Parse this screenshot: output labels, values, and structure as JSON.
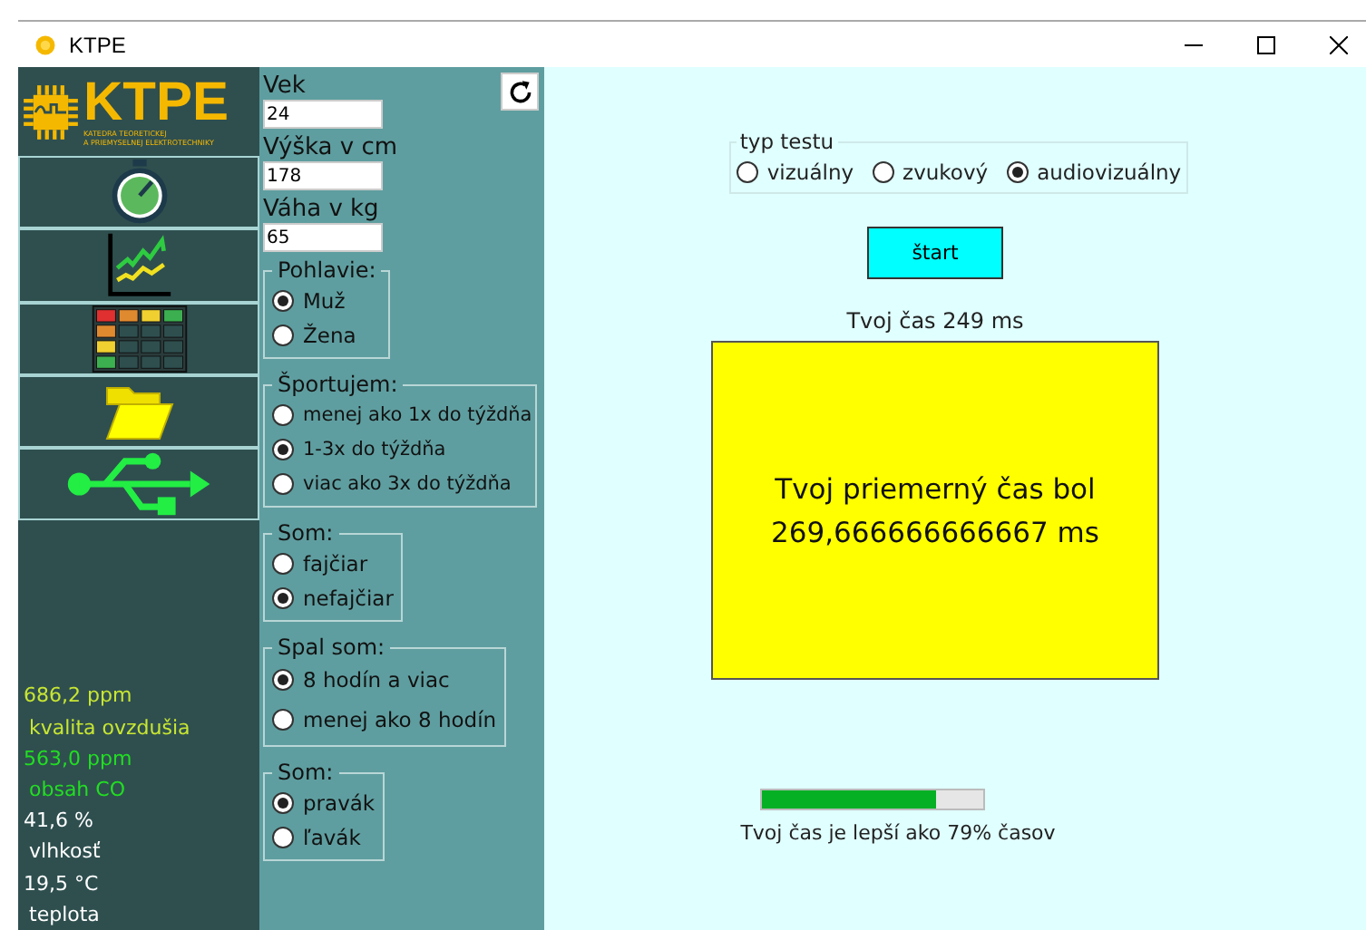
{
  "window": {
    "title": "KTPE"
  },
  "sidebar": {
    "logo": {
      "name": "KTPE",
      "subtitle_1": "KATEDRA TEORETICKEJ",
      "subtitle_2": "A PRIEMYSELNEJ ELEKTROTECHNIKY"
    },
    "nav": [
      {
        "kind": "stopwatch"
      },
      {
        "kind": "chart"
      },
      {
        "kind": "table"
      },
      {
        "kind": "folder"
      },
      {
        "kind": "usb"
      }
    ],
    "sensors": [
      {
        "value": "686,2 ppm",
        "label": "kvalita ovzdušia",
        "color": "#c8e632"
      },
      {
        "value": "563,0 ppm",
        "label": "obsah CO",
        "color": "#22dd22"
      },
      {
        "value": "41,6 %",
        "label": "vlhkosť",
        "color": "#ffffff"
      },
      {
        "value": "19,5 °C",
        "label": "teplota",
        "color": "#ffffff"
      }
    ]
  },
  "form": {
    "fields": [
      {
        "label": "Vek",
        "value": "24"
      },
      {
        "label": "Výška v cm",
        "value": "178"
      },
      {
        "label": "Váha v kg",
        "value": "65"
      }
    ],
    "groups": [
      {
        "title": "Pohlavie:",
        "options": [
          {
            "label": "Muž",
            "selected": true
          },
          {
            "label": "Žena",
            "selected": false
          }
        ]
      },
      {
        "title": "Športujem:",
        "options": [
          {
            "label": "menej ako 1x do týždňa",
            "selected": false
          },
          {
            "label": "1-3x do týždňa",
            "selected": true
          },
          {
            "label": "viac ako 3x do týždňa",
            "selected": false
          }
        ]
      },
      {
        "title": "Som:",
        "options": [
          {
            "label": "fajčiar",
            "selected": false
          },
          {
            "label": "nefajčiar",
            "selected": true
          }
        ]
      },
      {
        "title": "Spal som:",
        "options": [
          {
            "label": "8 hodín a viac",
            "selected": true
          },
          {
            "label": "menej ako 8 hodín",
            "selected": false
          }
        ]
      },
      {
        "title": "Som:",
        "options": [
          {
            "label": "pravák",
            "selected": true
          },
          {
            "label": "ľavák",
            "selected": false
          }
        ]
      }
    ]
  },
  "test": {
    "type_group": {
      "title": "typ testu",
      "options": [
        {
          "label": "vizuálny",
          "selected": false
        },
        {
          "label": "zvukový",
          "selected": false
        },
        {
          "label": "audiovizuálny",
          "selected": true
        }
      ]
    },
    "start_button": "štart",
    "last_time": "Tvoj čas 249 ms",
    "average_line_1": "Tvoj priemerný čas bol",
    "average_line_2": "269,666666666667 ms",
    "level": 0.79,
    "comparison": "Tvoj čas je lepší ako 79% časov"
  }
}
